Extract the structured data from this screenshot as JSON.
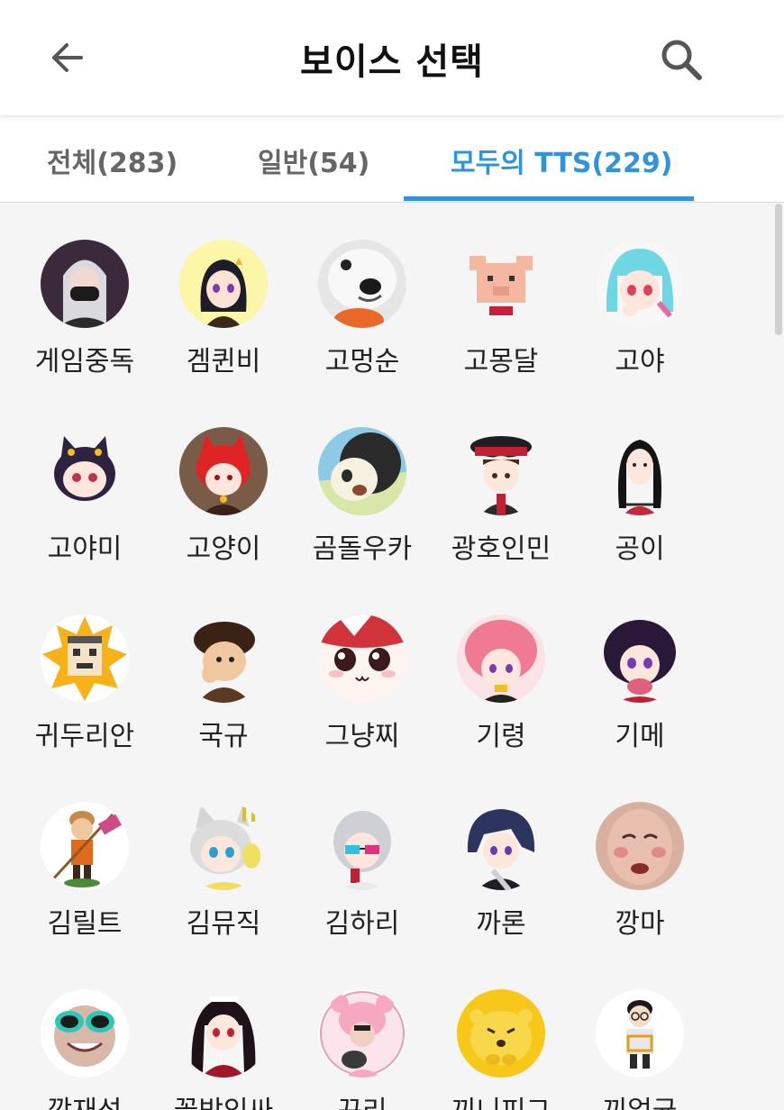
{
  "header": {
    "title": "보이스 선택",
    "back_icon": "arrow-left-icon",
    "search_icon": "search-icon"
  },
  "tabs": [
    {
      "label": "전체(283)",
      "active": false
    },
    {
      "label": "일반(54)",
      "active": false
    },
    {
      "label": "모두의 TTS(229)",
      "active": true
    }
  ],
  "colors": {
    "accent": "#2f94db",
    "background": "#f5f5f5"
  },
  "voices": [
    {
      "name": "게임중독",
      "avatar": "girl-mask-avatar"
    },
    {
      "name": "겜퀸비",
      "avatar": "anime-girl-avatar"
    },
    {
      "name": "고멍순",
      "avatar": "dog-avatar"
    },
    {
      "name": "고몽달",
      "avatar": "pixel-pig-avatar"
    },
    {
      "name": "고야",
      "avatar": "cyan-hair-girl-avatar"
    },
    {
      "name": "고야미",
      "avatar": "cat-girl-avatar"
    },
    {
      "name": "고양이",
      "avatar": "red-hair-cat-avatar"
    },
    {
      "name": "곰돌우카",
      "avatar": "panda-avatar"
    },
    {
      "name": "광호인민",
      "avatar": "officer-boy-avatar"
    },
    {
      "name": "공이",
      "avatar": "dark-hair-girl-avatar"
    },
    {
      "name": "귀두리안",
      "avatar": "pixel-sun-avatar"
    },
    {
      "name": "국규",
      "avatar": "brown-hair-boy-avatar"
    },
    {
      "name": "그냥찌",
      "avatar": "cute-face-avatar"
    },
    {
      "name": "기령",
      "avatar": "pink-hair-boy-avatar"
    },
    {
      "name": "기메",
      "avatar": "purple-hair-girl-avatar"
    },
    {
      "name": "김릴트",
      "avatar": "chibi-warrior-avatar"
    },
    {
      "name": "김뮤직",
      "avatar": "white-cat-girl-avatar"
    },
    {
      "name": "김하리",
      "avatar": "glasses-girl-avatar"
    },
    {
      "name": "까론",
      "avatar": "blue-hair-boy-avatar"
    },
    {
      "name": "깡마",
      "avatar": "real-face-avatar"
    },
    {
      "name": "깡재성",
      "avatar": "sunglasses-face-avatar"
    },
    {
      "name": "꼴받잉싸",
      "avatar": "gothic-girl-avatar"
    },
    {
      "name": "꾸리",
      "avatar": "bear-costume-avatar"
    },
    {
      "name": "끼니피그",
      "avatar": "yellow-hamster-avatar"
    },
    {
      "name": "끼얼균",
      "avatar": "glasses-boy-avatar"
    }
  ]
}
